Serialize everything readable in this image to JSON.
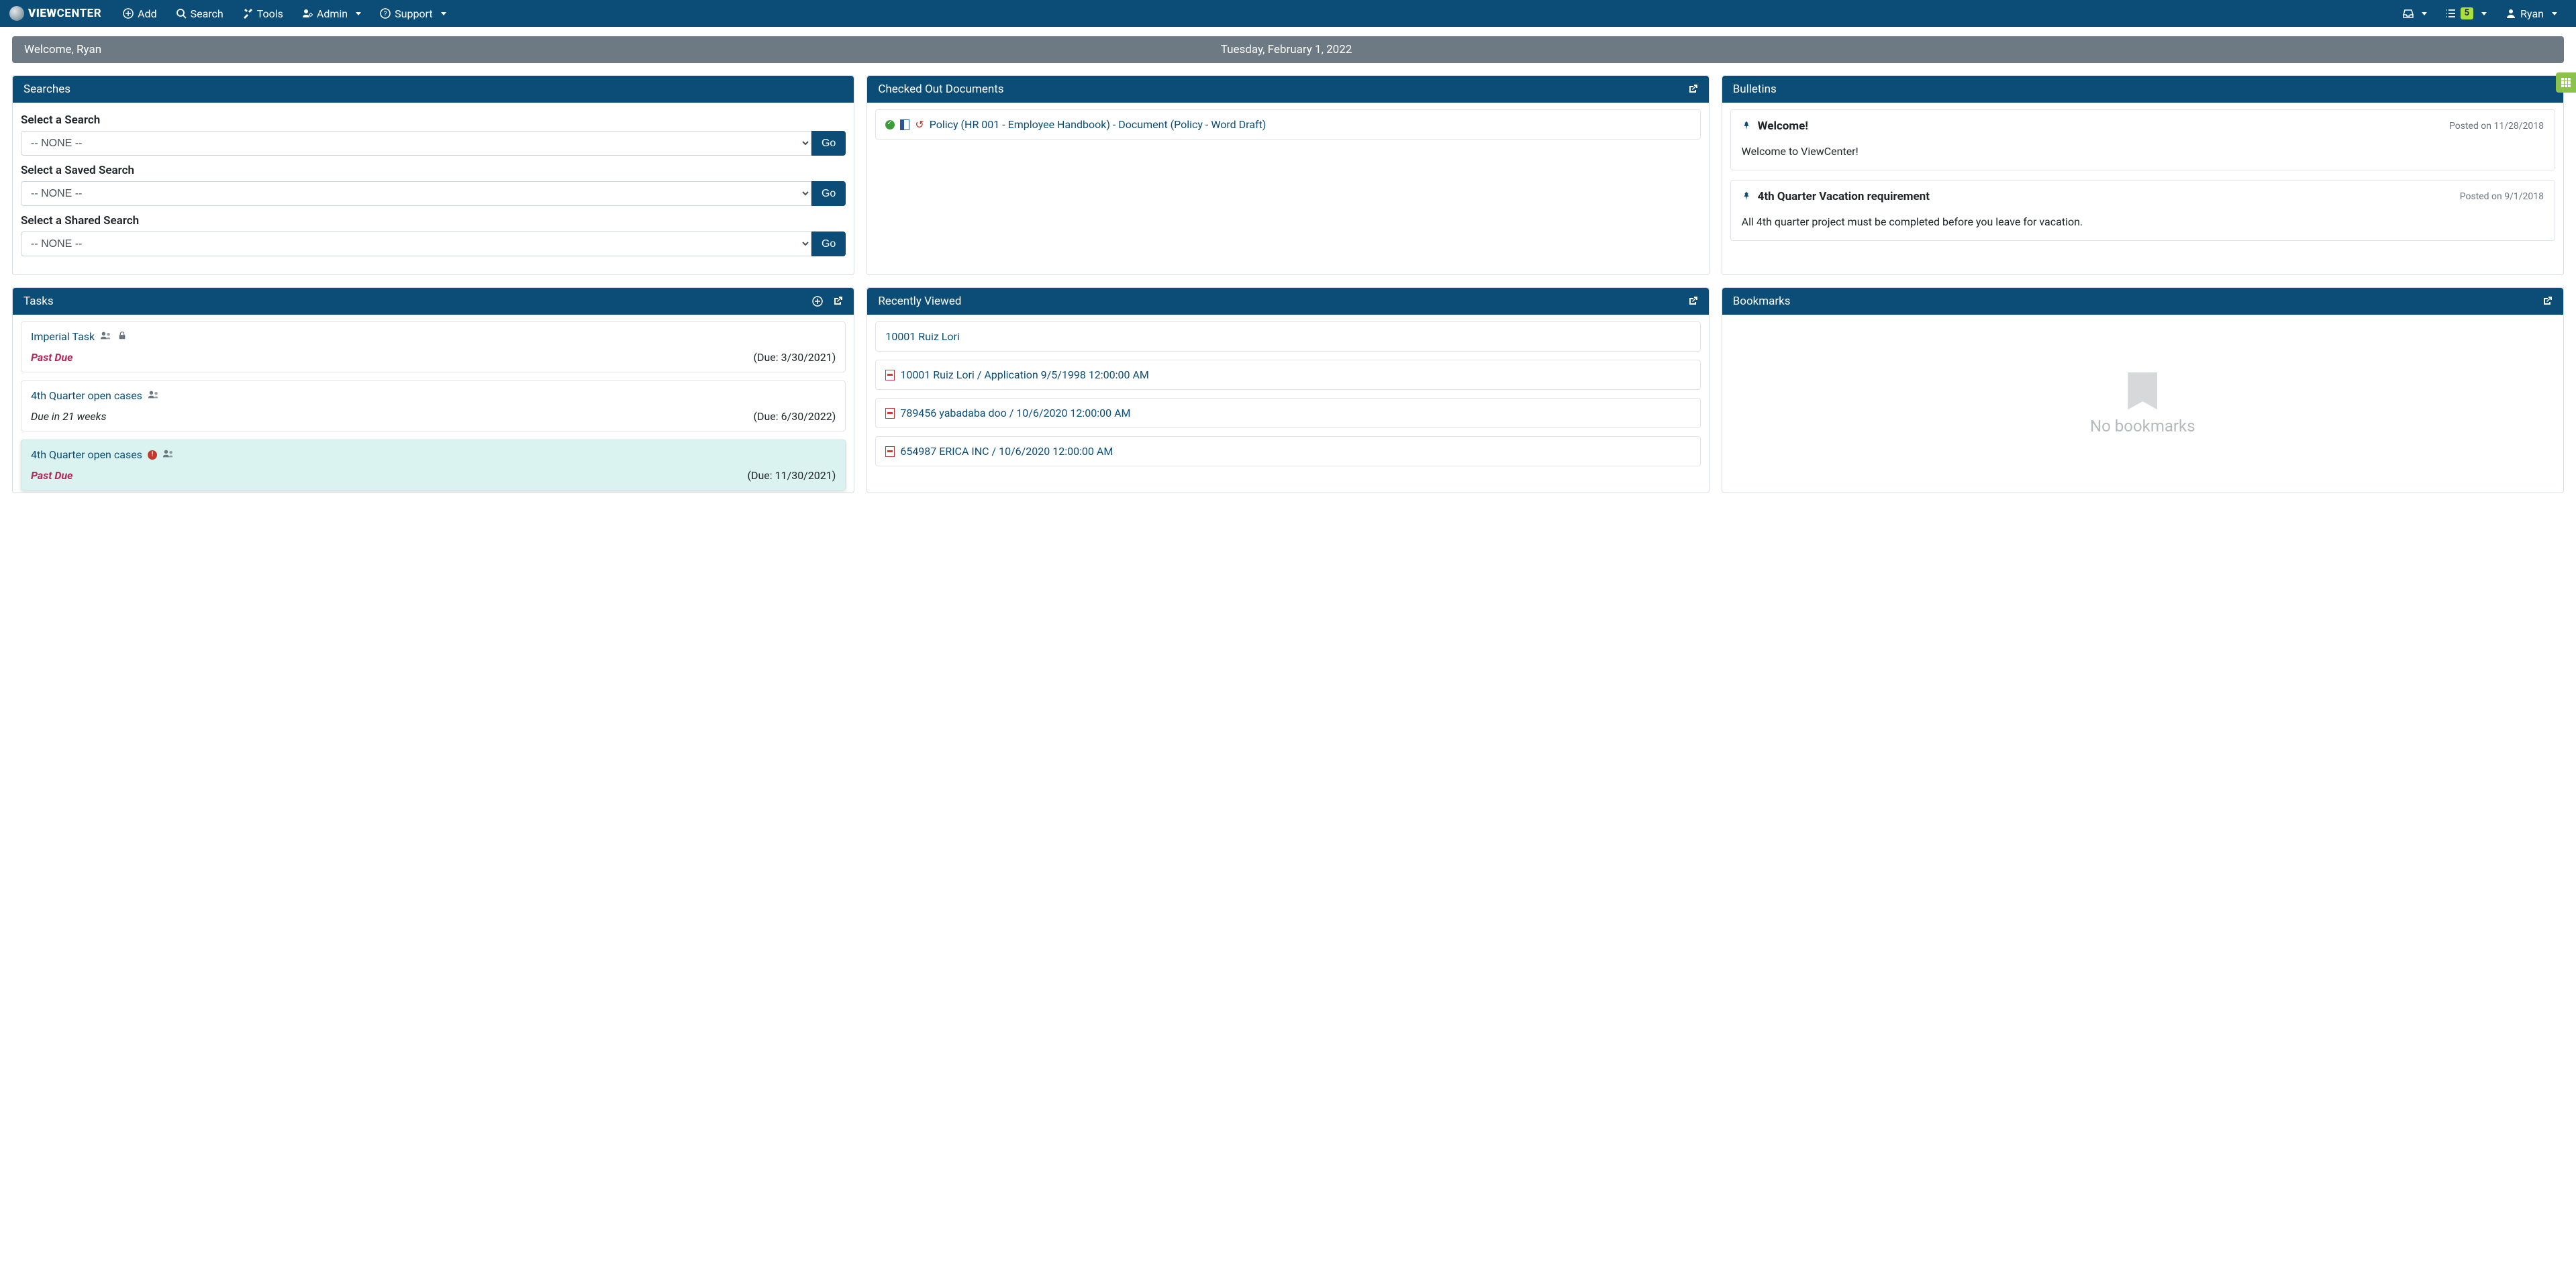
{
  "brand": {
    "bold": "VIEW",
    "rest": "CENTER"
  },
  "navbar": {
    "add": "Add",
    "search": "Search",
    "tools": "Tools",
    "admin": "Admin",
    "support": "Support",
    "task_count": "5",
    "user": "Ryan"
  },
  "welcome_bar": {
    "greeting": "Welcome, Ryan",
    "date": "Tuesday, February 1, 2022"
  },
  "panels": {
    "searches": {
      "title": "Searches",
      "select_search_label": "Select a Search",
      "select_saved_label": "Select a Saved Search",
      "select_shared_label": "Select a Shared Search",
      "none_option": "-- NONE --",
      "go": "Go"
    },
    "checked_out": {
      "title": "Checked Out Documents",
      "items": [
        {
          "title": "Policy (HR 001 - Employee Handbook) - Document (Policy - Word Draft)"
        }
      ]
    },
    "bulletins": {
      "title": "Bulletins",
      "items": [
        {
          "title": "Welcome!",
          "posted": "Posted on 11/28/2018",
          "body": "Welcome to ViewCenter!"
        },
        {
          "title": "4th Quarter Vacation requirement",
          "posted": "Posted on 9/1/2018",
          "body": "All 4th quarter project must be completed before you leave for vacation."
        }
      ]
    },
    "tasks": {
      "title": "Tasks",
      "items": [
        {
          "title": "Imperial Task",
          "status": "Past Due",
          "due": "(Due: 3/30/2021)",
          "past_due": true,
          "locked": true,
          "alert": false,
          "highlight": false
        },
        {
          "title": "4th Quarter open cases",
          "status": "Due in 21 weeks",
          "due": "(Due: 6/30/2022)",
          "past_due": false,
          "locked": false,
          "alert": false,
          "highlight": false
        },
        {
          "title": "4th Quarter open cases",
          "status": "Past Due",
          "due": "(Due: 11/30/2021)",
          "past_due": true,
          "locked": false,
          "alert": true,
          "highlight": true
        }
      ]
    },
    "recently_viewed": {
      "title": "Recently Viewed",
      "items": [
        {
          "title": "10001 Ruiz Lori",
          "icon": "none"
        },
        {
          "title": "10001 Ruiz Lori / Application 9/5/1998 12:00:00 AM",
          "icon": "pdf"
        },
        {
          "title": "789456 yabadaba doo / 10/6/2020 12:00:00 AM",
          "icon": "pdf"
        },
        {
          "title": "654987 ERICA INC / 10/6/2020 12:00:00 AM",
          "icon": "pdf"
        }
      ]
    },
    "bookmarks": {
      "title": "Bookmarks",
      "empty_text": "No bookmarks"
    }
  }
}
